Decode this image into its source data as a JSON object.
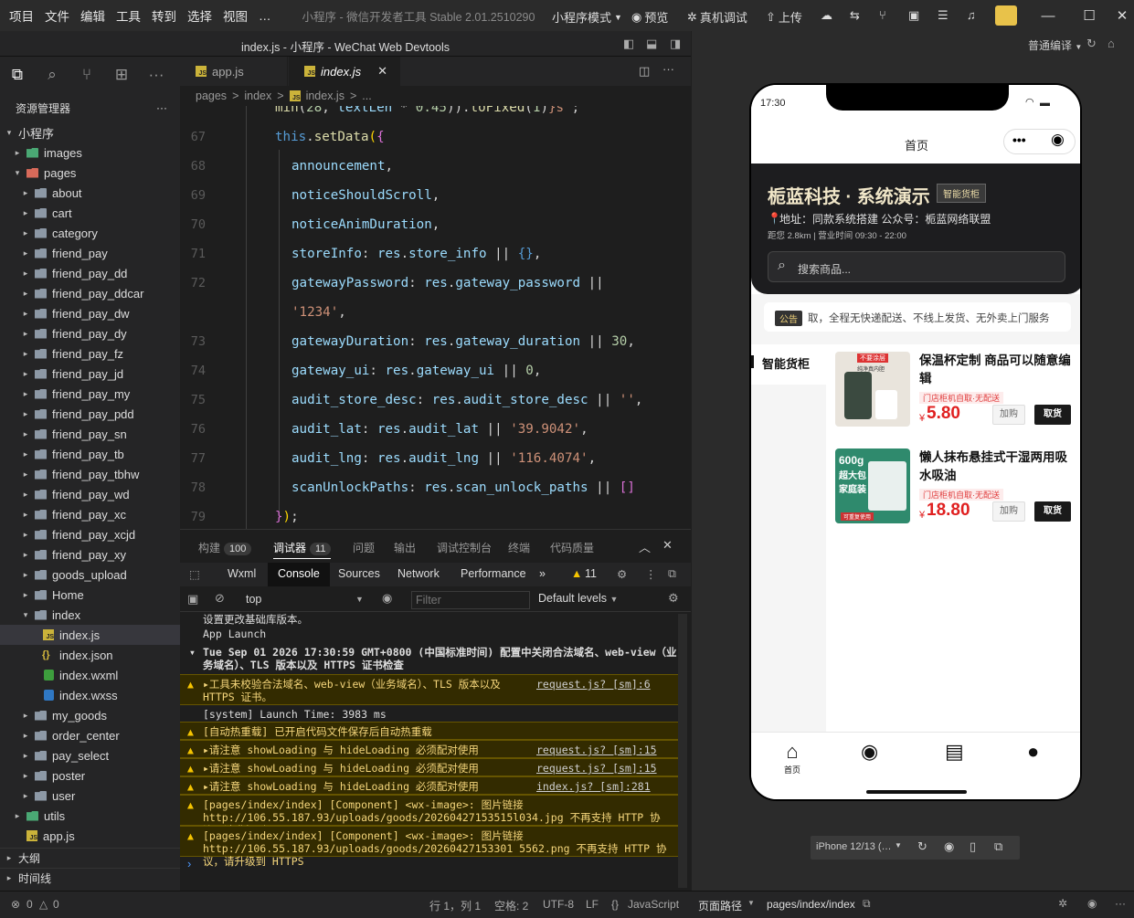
{
  "menu": [
    "项目",
    "文件",
    "编辑",
    "工具",
    "转到",
    "选择",
    "视图",
    "…"
  ],
  "app_title": "小程序 - 微信开发者工具 Stable 2.01.2510290",
  "toolbar": {
    "mode": "小程序模式",
    "preview": "预览",
    "real_debug": "真机调试",
    "upload": "上传"
  },
  "editor_title": "index.js - 小程序 - WeChat Web Devtools",
  "compile_mode": "普通编译",
  "explorer": {
    "title": "资源管理器",
    "root": "小程序"
  },
  "tree": [
    {
      "label": "images",
      "depth": 1,
      "type": "folder-green",
      "arrow": "▸"
    },
    {
      "label": "pages",
      "depth": 1,
      "type": "folder-red",
      "arrow": "▾"
    },
    {
      "label": "about",
      "depth": 2,
      "type": "folder",
      "arrow": "▸"
    },
    {
      "label": "cart",
      "depth": 2,
      "type": "folder",
      "arrow": "▸"
    },
    {
      "label": "category",
      "depth": 2,
      "type": "folder",
      "arrow": "▸"
    },
    {
      "label": "friend_pay",
      "depth": 2,
      "type": "folder",
      "arrow": "▸"
    },
    {
      "label": "friend_pay_dd",
      "depth": 2,
      "type": "folder",
      "arrow": "▸"
    },
    {
      "label": "friend_pay_ddcar",
      "depth": 2,
      "type": "folder",
      "arrow": "▸"
    },
    {
      "label": "friend_pay_dw",
      "depth": 2,
      "type": "folder",
      "arrow": "▸"
    },
    {
      "label": "friend_pay_dy",
      "depth": 2,
      "type": "folder",
      "arrow": "▸"
    },
    {
      "label": "friend_pay_fz",
      "depth": 2,
      "type": "folder",
      "arrow": "▸"
    },
    {
      "label": "friend_pay_jd",
      "depth": 2,
      "type": "folder",
      "arrow": "▸"
    },
    {
      "label": "friend_pay_my",
      "depth": 2,
      "type": "folder",
      "arrow": "▸"
    },
    {
      "label": "friend_pay_pdd",
      "depth": 2,
      "type": "folder",
      "arrow": "▸"
    },
    {
      "label": "friend_pay_sn",
      "depth": 2,
      "type": "folder",
      "arrow": "▸"
    },
    {
      "label": "friend_pay_tb",
      "depth": 2,
      "type": "folder",
      "arrow": "▸"
    },
    {
      "label": "friend_pay_tbhw",
      "depth": 2,
      "type": "folder",
      "arrow": "▸"
    },
    {
      "label": "friend_pay_wd",
      "depth": 2,
      "type": "folder",
      "arrow": "▸"
    },
    {
      "label": "friend_pay_xc",
      "depth": 2,
      "type": "folder",
      "arrow": "▸"
    },
    {
      "label": "friend_pay_xcjd",
      "depth": 2,
      "type": "folder",
      "arrow": "▸"
    },
    {
      "label": "friend_pay_xy",
      "depth": 2,
      "type": "folder",
      "arrow": "▸"
    },
    {
      "label": "goods_upload",
      "depth": 2,
      "type": "folder",
      "arrow": "▸"
    },
    {
      "label": "Home",
      "depth": 2,
      "type": "folder",
      "arrow": "▸"
    },
    {
      "label": "index",
      "depth": 2,
      "type": "folder-open",
      "arrow": "▾"
    },
    {
      "label": "index.js",
      "depth": 3,
      "type": "js",
      "arrow": "",
      "selected": true
    },
    {
      "label": "index.json",
      "depth": 3,
      "type": "json",
      "arrow": ""
    },
    {
      "label": "index.wxml",
      "depth": 3,
      "type": "wxml",
      "arrow": ""
    },
    {
      "label": "index.wxss",
      "depth": 3,
      "type": "wxss",
      "arrow": ""
    },
    {
      "label": "my_goods",
      "depth": 2,
      "type": "folder",
      "arrow": "▸"
    },
    {
      "label": "order_center",
      "depth": 2,
      "type": "folder",
      "arrow": "▸"
    },
    {
      "label": "pay_select",
      "depth": 2,
      "type": "folder",
      "arrow": "▸"
    },
    {
      "label": "poster",
      "depth": 2,
      "type": "folder",
      "arrow": "▸"
    },
    {
      "label": "user",
      "depth": 2,
      "type": "folder",
      "arrow": "▸"
    },
    {
      "label": "utils",
      "depth": 1,
      "type": "folder-green",
      "arrow": "▸"
    },
    {
      "label": "app.js",
      "depth": 1,
      "type": "js",
      "arrow": ""
    }
  ],
  "sections": {
    "outline": "大纲",
    "timeline": "时间线"
  },
  "tabs": [
    {
      "label": "app.js"
    },
    {
      "label": "index.js"
    }
  ],
  "breadcrumb": [
    "pages",
    ">",
    "index",
    ">",
    "index.js",
    ">",
    "..."
  ],
  "code_lines": [
    {
      "n": "",
      "html": "<span class='f'>min</span><span class='o'>(</span><span class='n'>28</span><span class='o'>, </span><span class='p'>textLen</span><span class='o'> * </span><span class='n'>0.45</span><span class='o'>)).</span><span class='f'>toFixed</span><span class='o'>(</span><span class='n'>1</span><span class='o'>)</span><span class='s'>}s`</span><span class='o'>;</span>",
      "indent": 104
    },
    {
      "n": "67",
      "html": "<span class='k'>this</span><span class='o'>.</span><span class='f'>setData</span><span class='b'>(</span><span class='b2'>{</span>",
      "indent": 104
    },
    {
      "n": "68",
      "html": "<span class='p'>announcement</span><span class='o'>,</span>",
      "indent": 122
    },
    {
      "n": "69",
      "html": "<span class='p'>noticeShouldScroll</span><span class='o'>,</span>",
      "indent": 122
    },
    {
      "n": "70",
      "html": "<span class='p'>noticeAnimDuration</span><span class='o'>,</span>",
      "indent": 122
    },
    {
      "n": "71",
      "html": "<span class='p'>storeInfo</span><span class='o'>: </span><span class='p'>res</span><span class='o'>.</span><span class='p'>store_info</span><span class='o'> || </span><span class='k'>{}</span><span class='o'>,</span>",
      "indent": 122
    },
    {
      "n": "72",
      "html": "<span class='p'>gatewayPassword</span><span class='o'>: </span><span class='p'>res</span><span class='o'>.</span><span class='p'>gateway_password</span><span class='o'> ||</span>",
      "indent": 122
    },
    {
      "n": "",
      "html": "<span class='s'>'1234'</span><span class='o'>,</span>",
      "indent": 122
    },
    {
      "n": "73",
      "html": "<span class='p'>gatewayDuration</span><span class='o'>: </span><span class='p'>res</span><span class='o'>.</span><span class='p'>gateway_duration</span><span class='o'> || </span><span class='n'>30</span><span class='o'>,</span>",
      "indent": 122
    },
    {
      "n": "74",
      "html": "<span class='p'>gateway_ui</span><span class='o'>: </span><span class='p'>res</span><span class='o'>.</span><span class='p'>gateway_ui</span><span class='o'> || </span><span class='n'>0</span><span class='o'>,</span>",
      "indent": 122
    },
    {
      "n": "75",
      "html": "<span class='p'>audit_store_desc</span><span class='o'>: </span><span class='p'>res</span><span class='o'>.</span><span class='p'>audit_store_desc</span><span class='o'> || </span><span class='s'>''</span><span class='o'>,</span>",
      "indent": 122
    },
    {
      "n": "76",
      "html": "<span class='p'>audit_lat</span><span class='o'>: </span><span class='p'>res</span><span class='o'>.</span><span class='p'>audit_lat</span><span class='o'> || </span><span class='s'>'39.9042'</span><span class='o'>,</span>",
      "indent": 122
    },
    {
      "n": "77",
      "html": "<span class='p'>audit_lng</span><span class='o'>: </span><span class='p'>res</span><span class='o'>.</span><span class='p'>audit_lng</span><span class='o'> || </span><span class='s'>'116.4074'</span><span class='o'>,</span>",
      "indent": 122
    },
    {
      "n": "78",
      "html": "<span class='p'>scanUnlockPaths</span><span class='o'>: </span><span class='p'>res</span><span class='o'>.</span><span class='p'>scan_unlock_paths</span><span class='o'> || </span><span class='b2'>[]</span>",
      "indent": 122
    },
    {
      "n": "79",
      "html": "<span class='b2'>}</span><span class='b'>)</span><span class='o'>;</span>",
      "indent": 104
    }
  ],
  "panel_tabs": [
    {
      "label": "构建",
      "badge": "100"
    },
    {
      "label": "调试器",
      "badge": "11"
    },
    {
      "label": "问题"
    },
    {
      "label": "输出"
    },
    {
      "label": "调试控制台"
    },
    {
      "label": "终端"
    },
    {
      "label": "代码质量"
    }
  ],
  "devtools_tabs": [
    "Wxml",
    "Console",
    "Sources",
    "Network",
    "Performance",
    "»"
  ],
  "warn_count": "11",
  "console_context": "top",
  "filter_placeholder": "Filter",
  "default_levels": "Default levels",
  "logs": [
    {
      "text": "设置更改基础库版本。",
      "type": "info"
    },
    {
      "text": "App Launch",
      "type": "info"
    },
    {
      "text": "Tue Sep 01 2026 17:30:59 GMT+0800 (中国标准时间) 配置中关闭合法域名、web-view（业务域名）、TLS 版本以及 HTTPS 证书检查",
      "type": "group"
    },
    {
      "text": "▸工具未校验合法域名、web-view（业务域名）、TLS 版本以及 HTTPS 证书。",
      "type": "warn",
      "src": "request.js? [sm]:6"
    },
    {
      "text": "[system] Launch Time: 3983 ms",
      "type": "info"
    },
    {
      "text": "[自动热重载] 已开启代码文件保存后自动热重载",
      "type": "warn"
    },
    {
      "text": "▸请注意 showLoading 与 hideLoading 必须配对使用",
      "type": "warn",
      "src": "request.js? [sm]:15"
    },
    {
      "text": "▸请注意 showLoading 与 hideLoading 必须配对使用",
      "type": "warn",
      "src": "request.js? [sm]:15"
    },
    {
      "text": "▸请注意 showLoading 与 hideLoading 必须配对使用",
      "type": "warn",
      "src": "index.js? [sm]:281"
    },
    {
      "text": "[pages/index/index] [Component] <wx-image>: 图片链接 http://106.55.187.93/uploads/goods/20260427153515l034.jpg 不再支持 HTTP 协议，请升级到 HTTPS",
      "type": "warn"
    },
    {
      "text": "[pages/index/index] [Component] <wx-image>: 图片链接 http://106.55.187.93/uploads/goods/20260427153301 5562.png 不再支持 HTTP 协议，请升级到 HTTPS",
      "type": "warn"
    }
  ],
  "status": {
    "errors": "0",
    "warnings": "0",
    "position": "行 1，列 1",
    "spaces": "空格: 2",
    "encoding": "UTF-8",
    "eol": "LF",
    "lang": "JavaScript",
    "page_path_label": "页面路径",
    "page_path": "pages/index/index"
  },
  "device": "iPhone 12/13 (…",
  "phone": {
    "time": "17:30",
    "nav_title": "首页",
    "store_name": "栀蓝科技 · 系统演示",
    "store_tag": "智能货柜",
    "address": "地址：同款系统搭建 公众号：栀蓝网络联盟",
    "distance": "距您 2.8km | 营业时间 09:30 - 22:00",
    "search_placeholder": "搜索商品...",
    "notice_tag": "公告",
    "notice": "取，全程无快递配送、不线上发货、无外卖上门服务",
    "category": "智能货柜",
    "products": [
      {
        "name": "保温杯定制 商品可以随意编辑",
        "tag": "门店柜机自取·无配送",
        "price_symbol": "¥",
        "price": "5.80",
        "btn_add": "加购",
        "btn_take": "取货",
        "img_label_top": "不要涂层",
        "img_label_sub": "纯净真内胆"
      },
      {
        "name": "懒人抹布悬挂式干湿两用吸水吸油",
        "tag": "门店柜机自取·无配送",
        "price_symbol": "¥",
        "price": "18.80",
        "btn_add": "加购",
        "btn_take": "取货",
        "img_label_top": "600g",
        "img_label_sub": "超大包",
        "img_label_3": "家庭装",
        "img_label_4": "可重复使用"
      }
    ],
    "tabbar": [
      "首页"
    ]
  }
}
